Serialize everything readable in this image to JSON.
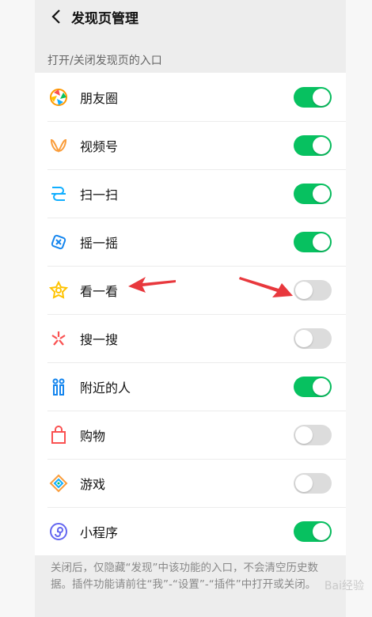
{
  "header": {
    "title": "发现页管理"
  },
  "section_title": "打开/关闭发现页的入口",
  "items": [
    {
      "label": "朋友圈",
      "icon": "moments-icon",
      "on": true
    },
    {
      "label": "视频号",
      "icon": "channels-icon",
      "on": true
    },
    {
      "label": "扫一扫",
      "icon": "scan-icon",
      "on": true
    },
    {
      "label": "摇一摇",
      "icon": "shake-icon",
      "on": true
    },
    {
      "label": "看一看",
      "icon": "top-stories-icon",
      "on": false
    },
    {
      "label": "搜一搜",
      "icon": "search-icon",
      "on": false
    },
    {
      "label": "附近的人",
      "icon": "people-nearby-icon",
      "on": true
    },
    {
      "label": "购物",
      "icon": "shopping-bag-icon",
      "on": false
    },
    {
      "label": "游戏",
      "icon": "games-icon",
      "on": false
    },
    {
      "label": "小程序",
      "icon": "mini-programs-icon",
      "on": true
    }
  ],
  "footer_text": "关闭后，仅隐藏“发现”中该功能的入口，不会清空历史数据。插件功能请前往“我”-“设置”-“插件”中打开或关闭。",
  "watermark": "Bai经验",
  "colors": {
    "toggle_on": "#07c160",
    "toggle_off": "#dcdcdc",
    "annotation_arrow": "#e8383d"
  }
}
